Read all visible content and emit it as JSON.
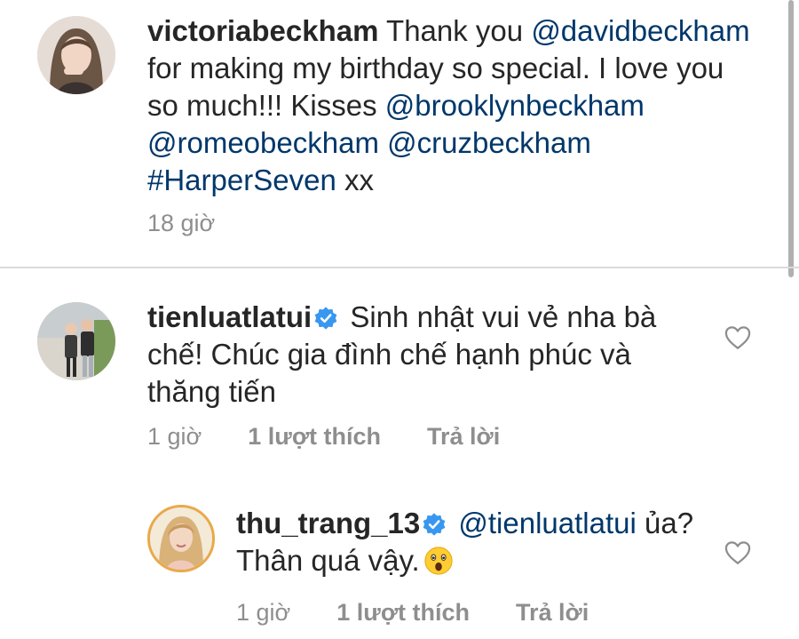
{
  "caption": {
    "username": "victoriabeckham",
    "text_1": "Thank you",
    "mention_1": "@davidbeckham",
    "text_2": "for making my birthday so special. I love you so much!!! Kisses",
    "mention_2": "@brooklynbeckham",
    "mention_3": "@romeobeckham",
    "mention_4": "@cruzbeckham",
    "hashtag": "#HarperSeven",
    "text_3": "xx",
    "time": "18 giờ"
  },
  "comments": [
    {
      "username": "tienluatlatui",
      "verified": true,
      "text": "Sinh nhật vui vẻ nha bà chế! Chúc gia đình chế hạnh phúc và thăng tiến",
      "time": "1 giờ",
      "likes": "1 lượt thích",
      "reply_label": "Trả lời"
    }
  ],
  "reply": {
    "username": "thu_trang_13",
    "verified": true,
    "mention": "@tienluatlatui",
    "text": "ủa? Thân quá vậy.",
    "emoji": "astonished-face-emoji",
    "time": "1 giờ",
    "likes": "1 lượt thích",
    "reply_label": "Trả lời"
  },
  "colors": {
    "text": "#262626",
    "link": "#00376b",
    "muted": "#8e8e8e",
    "verified": "#3897f0",
    "divider": "#dbdbdb"
  }
}
